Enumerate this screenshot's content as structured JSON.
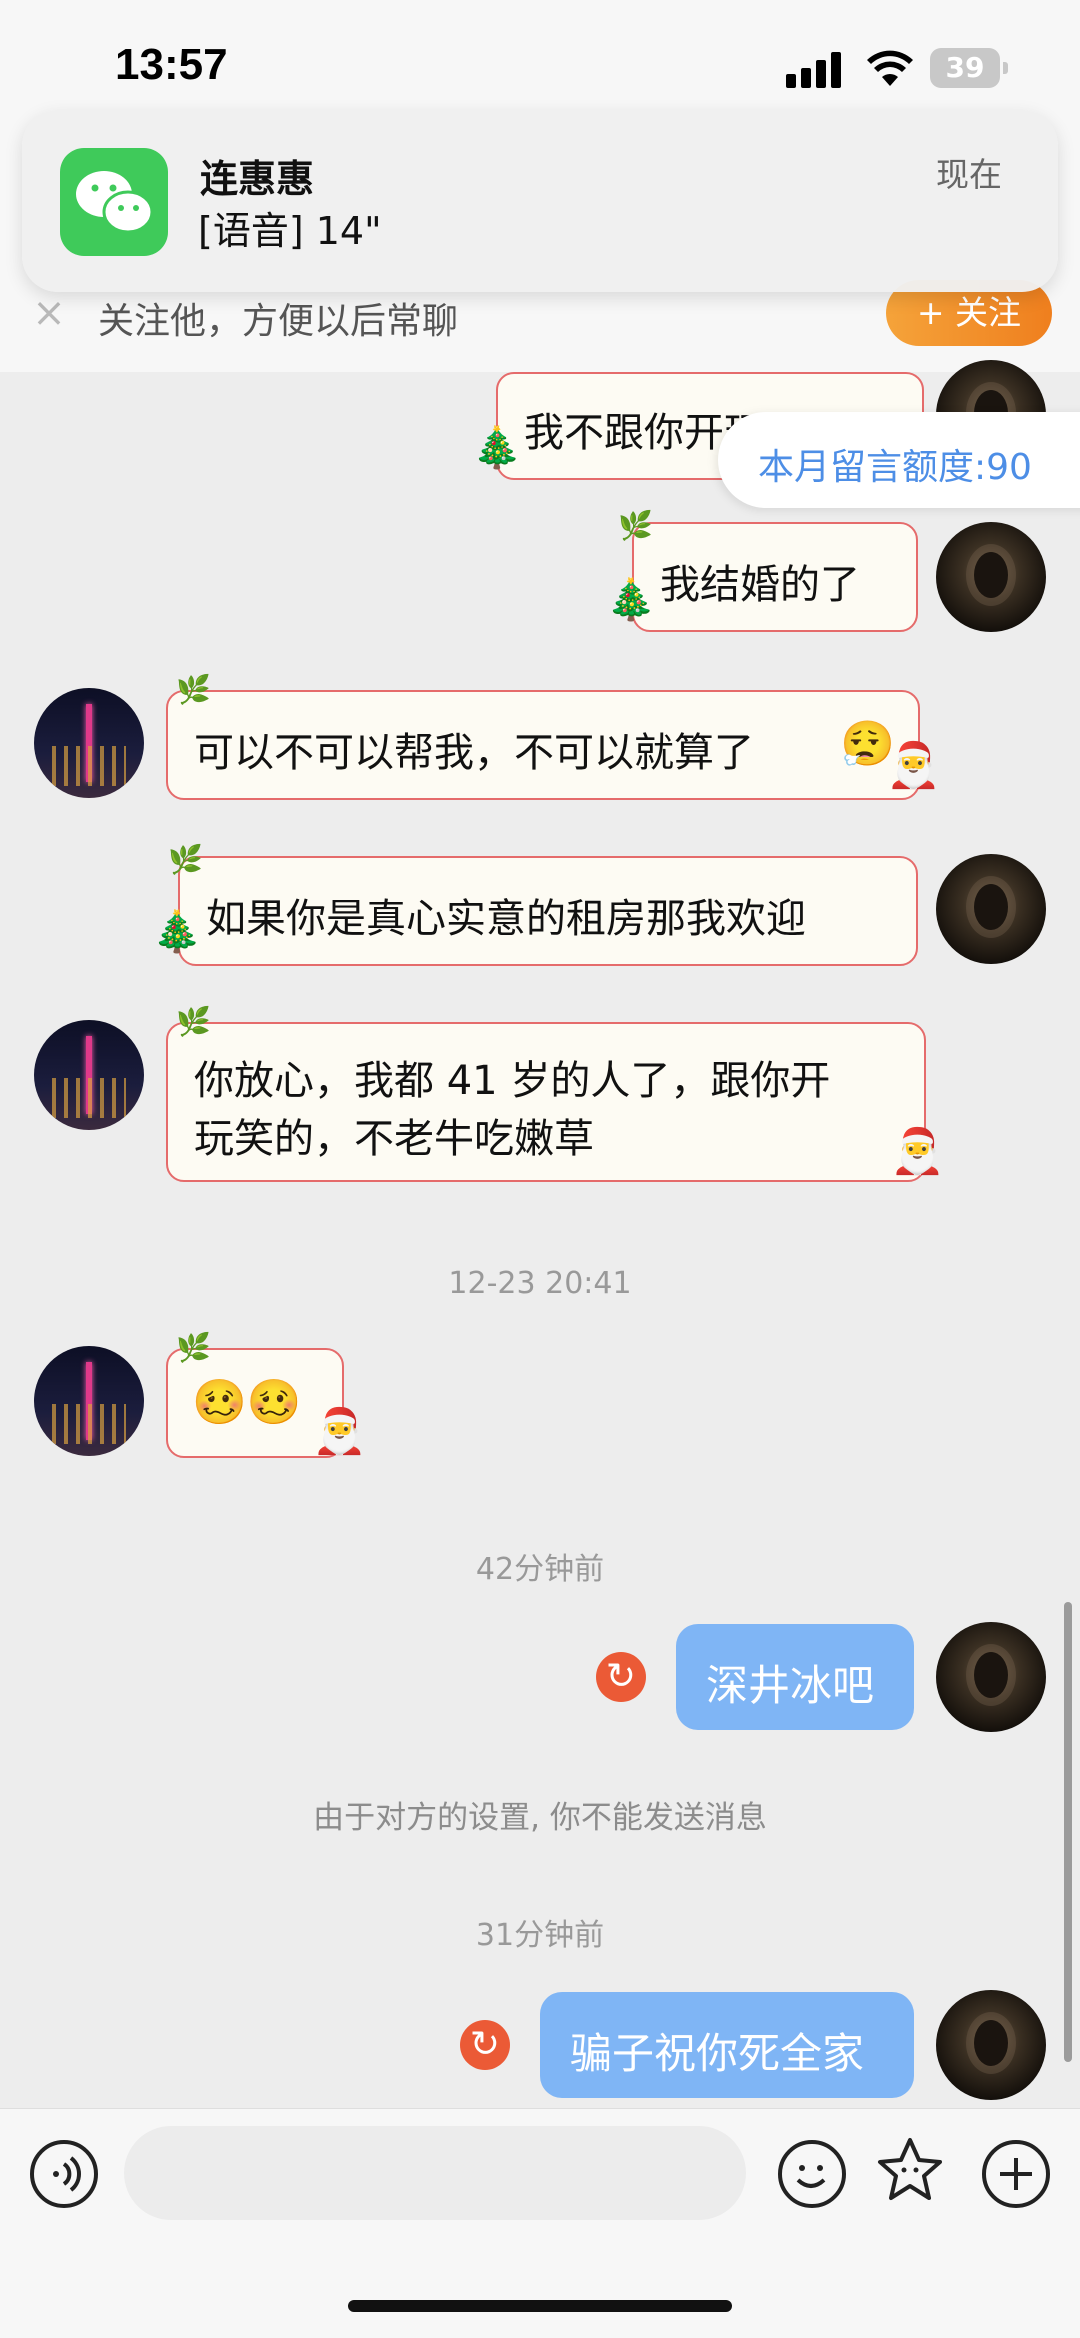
{
  "status_bar": {
    "time": "13:57",
    "battery": "39"
  },
  "notification": {
    "app_icon": "wechat-icon",
    "title": "连惠惠",
    "body": "[语音] 14\"",
    "time": "现在"
  },
  "follow_bar": {
    "text": "关注他，方便以后常聊",
    "button": "+ 关注"
  },
  "quota": "本月留言额度:90",
  "messages": [
    {
      "from": "me",
      "text": "我不跟你开玩笑哈",
      "style": "festive"
    },
    {
      "from": "me",
      "text": "我结婚的了",
      "style": "festive"
    },
    {
      "from": "other",
      "text": "可以不可以帮我，不可以就算了",
      "style": "festive"
    },
    {
      "from": "me",
      "text": "如果你是真心实意的租房那我欢迎",
      "style": "festive"
    },
    {
      "from": "other",
      "line1": "你放心，我都 41 岁的人了，跟你开",
      "line2": "玩笑的，不老牛吃嫩草",
      "style": "festive"
    },
    {
      "from": "other",
      "text": "🥴🥴",
      "style": "festive"
    },
    {
      "from": "me",
      "text": "深井冰吧",
      "style": "blue",
      "failed": true
    },
    {
      "from": "me",
      "text": "骗子祝你死全家",
      "style": "blue",
      "failed": true
    }
  ],
  "timestamps": [
    "12-23 20:41",
    "42分钟前",
    "31分钟前"
  ],
  "system_notice": "由于对方的设置, 你不能发送消息",
  "input": {
    "placeholder": "",
    "voice_icon": "voice-icon",
    "emoji_icon": "emoji-icon",
    "sticker_icon": "sticker-icon",
    "plus_icon": "plus-icon"
  },
  "colors": {
    "bubble_border": "#e56b6b",
    "blue_bubble": "#7fb5f5",
    "follow_btn": "#f08a24",
    "retry": "#eb5a36"
  }
}
